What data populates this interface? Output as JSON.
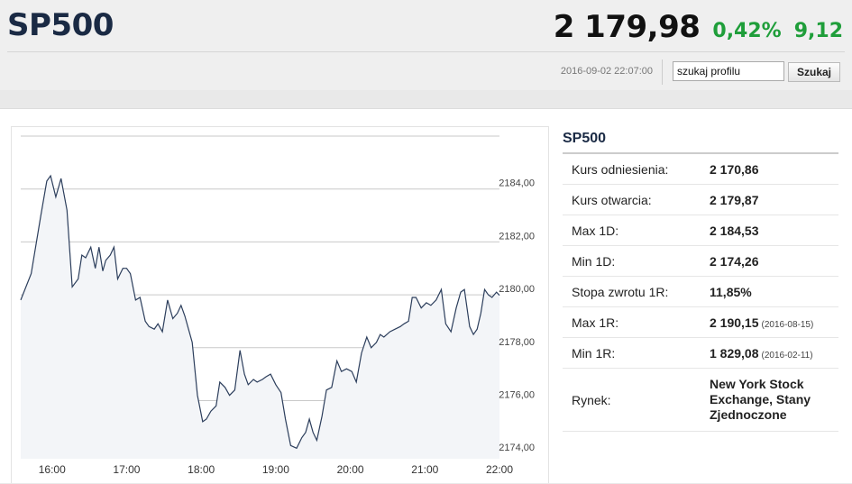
{
  "header": {
    "ticker": "SP500",
    "price": "2 179,98",
    "change_pct": "0,42%",
    "change_abs": "9,12",
    "timestamp": "2016-09-02 22:07:00"
  },
  "search": {
    "value": "szukaj profilu",
    "button_label": "Szukaj"
  },
  "colors": {
    "positive": "#1f9e3a",
    "line": "#2c3e5c",
    "area": "#f3f5f8",
    "ticker": "#1a2a44"
  },
  "info": {
    "title": "SP500",
    "rows": [
      {
        "label": "Kurs odniesienia:",
        "value": "2 170,86",
        "date": ""
      },
      {
        "label": "Kurs otwarcia:",
        "value": "2 179,87",
        "date": ""
      },
      {
        "label": "Max 1D:",
        "value": "2 184,53",
        "date": ""
      },
      {
        "label": "Min 1D:",
        "value": "2 174,26",
        "date": ""
      },
      {
        "label": "Stopa zwrotu 1R:",
        "value": "11,85%",
        "date": ""
      },
      {
        "label": "Max 1R:",
        "value": "2 190,15",
        "date": "(2016-08-15)"
      },
      {
        "label": "Min 1R:",
        "value": "1 829,08",
        "date": "(2016-02-11)"
      },
      {
        "label": "Rynek:",
        "value": "New York Stock Exchange, Stany Zjednoczone",
        "date": ""
      }
    ]
  },
  "chart_data": {
    "type": "area",
    "x_ticks": [
      "16:00",
      "17:00",
      "18:00",
      "19:00",
      "20:00",
      "21:00",
      "22:00"
    ],
    "y_ticks": [
      "2174,00",
      "2176,00",
      "2178,00",
      "2180,00",
      "2182,00",
      "2184,00"
    ],
    "xlim": [
      15.58,
      22.0
    ],
    "ylim": [
      2173.8,
      2186.0
    ],
    "grid": true,
    "series": [
      {
        "x": [
          15.58,
          15.72,
          15.85,
          15.93,
          15.98,
          16.05,
          16.12,
          16.2,
          16.27,
          16.35,
          16.4,
          16.45,
          16.52,
          16.58,
          16.63,
          16.68,
          16.72,
          16.78,
          16.83,
          16.88,
          16.95,
          17.0,
          17.05,
          17.12,
          17.18,
          17.25,
          17.3,
          17.37,
          17.42,
          17.48,
          17.55,
          17.62,
          17.68,
          17.73,
          17.78,
          17.83,
          17.88,
          17.95,
          18.02,
          18.07,
          18.13,
          18.2,
          18.25,
          18.32,
          18.38,
          18.45,
          18.52,
          18.58,
          18.63,
          18.7,
          18.75,
          18.82,
          18.87,
          18.93,
          19.0,
          19.07,
          19.13,
          19.2,
          19.28,
          19.35,
          19.4,
          19.45,
          19.5,
          19.55,
          19.62,
          19.68,
          19.75,
          19.82,
          19.88,
          19.95,
          20.02,
          20.08,
          20.15,
          20.22,
          20.28,
          20.35,
          20.4,
          20.45,
          20.53,
          20.6,
          20.67,
          20.72,
          20.78,
          20.83,
          20.88,
          20.95,
          21.02,
          21.08,
          21.15,
          21.22,
          21.28,
          21.35,
          21.42,
          21.48,
          21.53,
          21.6,
          21.65,
          21.7,
          21.75,
          21.8,
          21.85,
          21.9,
          21.96,
          22.0
        ],
        "y": [
          2179.8,
          2180.8,
          2183.0,
          2184.3,
          2184.5,
          2183.7,
          2184.4,
          2183.2,
          2180.3,
          2180.6,
          2181.5,
          2181.4,
          2181.8,
          2181.0,
          2181.8,
          2180.9,
          2181.3,
          2181.5,
          2181.8,
          2180.6,
          2181.0,
          2181.0,
          2180.8,
          2179.8,
          2179.9,
          2179.0,
          2178.8,
          2178.7,
          2178.9,
          2178.6,
          2179.8,
          2179.1,
          2179.3,
          2179.6,
          2179.2,
          2178.7,
          2178.2,
          2176.2,
          2175.2,
          2175.3,
          2175.6,
          2175.8,
          2176.7,
          2176.5,
          2176.2,
          2176.4,
          2177.9,
          2177.0,
          2176.6,
          2176.8,
          2176.7,
          2176.8,
          2176.9,
          2177.0,
          2176.6,
          2176.3,
          2175.3,
          2174.3,
          2174.2,
          2174.6,
          2174.8,
          2175.3,
          2174.8,
          2174.5,
          2175.4,
          2176.4,
          2176.5,
          2177.5,
          2177.1,
          2177.2,
          2177.1,
          2176.7,
          2177.8,
          2178.4,
          2178.0,
          2178.2,
          2178.5,
          2178.4,
          2178.6,
          2178.7,
          2178.8,
          2178.9,
          2179.0,
          2179.9,
          2179.9,
          2179.5,
          2179.7,
          2179.6,
          2179.8,
          2180.2,
          2178.9,
          2178.6,
          2179.5,
          2180.1,
          2180.2,
          2178.8,
          2178.5,
          2178.7,
          2179.3,
          2180.2,
          2180.0,
          2179.9,
          2180.1,
          2179.98
        ]
      }
    ]
  }
}
